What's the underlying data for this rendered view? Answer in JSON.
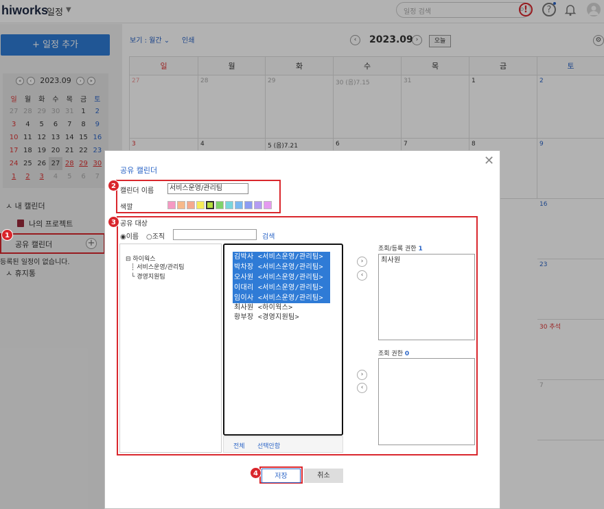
{
  "header": {
    "logo": "hiworks",
    "menu_title": "일정",
    "search_placeholder": "일정 검색",
    "alert_icon": "!",
    "help_icon": "?"
  },
  "sidebar": {
    "add_button": "+ 일정 추가",
    "minical": {
      "month": "2023.09",
      "weekdays": [
        "일",
        "월",
        "화",
        "수",
        "목",
        "금",
        "토"
      ],
      "weeks": [
        [
          "27",
          "28",
          "29",
          "30",
          "31",
          "1",
          "2"
        ],
        [
          "3",
          "4",
          "5",
          "6",
          "7",
          "8",
          "9"
        ],
        [
          "10",
          "11",
          "12",
          "13",
          "14",
          "15",
          "16"
        ],
        [
          "17",
          "18",
          "19",
          "20",
          "21",
          "22",
          "23"
        ],
        [
          "24",
          "25",
          "26",
          "27",
          "28",
          "29",
          "30"
        ],
        [
          "1",
          "2",
          "3",
          "4",
          "5",
          "6",
          "7"
        ]
      ]
    },
    "my_calendar": "내 캘린더",
    "my_project": "나의 프로젝트",
    "shared_calendar": "공유 캘린더",
    "no_events": "등록된 일정이 없습니다.",
    "trash": "휴지통"
  },
  "toolbar": {
    "view": "보기 : 월간",
    "print": "인쇄",
    "month": "2023.09",
    "today": "오늘"
  },
  "calendar": {
    "weekdays": [
      "일",
      "월",
      "화",
      "수",
      "목",
      "금",
      "토"
    ],
    "week1": [
      "27",
      "28",
      "29",
      "30 (음)7.15",
      "31",
      "1",
      "2"
    ],
    "week2": [
      "3",
      "4",
      "5 (음)7.21",
      "6",
      "7",
      "8",
      "9"
    ],
    "side_dates": [
      "16",
      "23",
      "30 추석",
      "7"
    ]
  },
  "dialog": {
    "title": "공유 캘린더",
    "name_label": "캘린더 이름",
    "name_value": "서비스운영/관리팀",
    "color_label": "색깔",
    "colors": [
      "#f59ac3",
      "#f7b98a",
      "#f5a98f",
      "#f7ec5a",
      "#b6dd3c",
      "#7fd36b",
      "#78d6dd",
      "#7ab8f0",
      "#8d9cf2",
      "#b49cf2",
      "#e59af0"
    ],
    "target_label": "공유 대상",
    "radio_name": "이름",
    "radio_org": "조직",
    "search_btn": "검색",
    "tree": [
      "하이웍스",
      "서비스운영/관리팀",
      "경영지원팀"
    ],
    "selected_members": [
      "김박사 <서비스운영/관리팀>",
      "박차장 <서비스운영/관리팀>",
      "오사원 <서비스운영/관리팀>",
      "이대리 <서비스운영/관리팀>",
      "임이사 <서비스운영/관리팀>"
    ],
    "other_members": [
      "최사원 <하이웍스>",
      "황부장 <경영지원팀>"
    ],
    "select_all": "전체",
    "deselect": "선택안함",
    "edit_perm_label": "조회/등록 권한",
    "edit_perm_count": "1",
    "edit_perm_members": [
      "최사원"
    ],
    "view_perm_label": "조회 권한",
    "view_perm_count": "0",
    "save": "저장",
    "cancel": "취소"
  },
  "badges": [
    "1",
    "2",
    "3",
    "4"
  ]
}
